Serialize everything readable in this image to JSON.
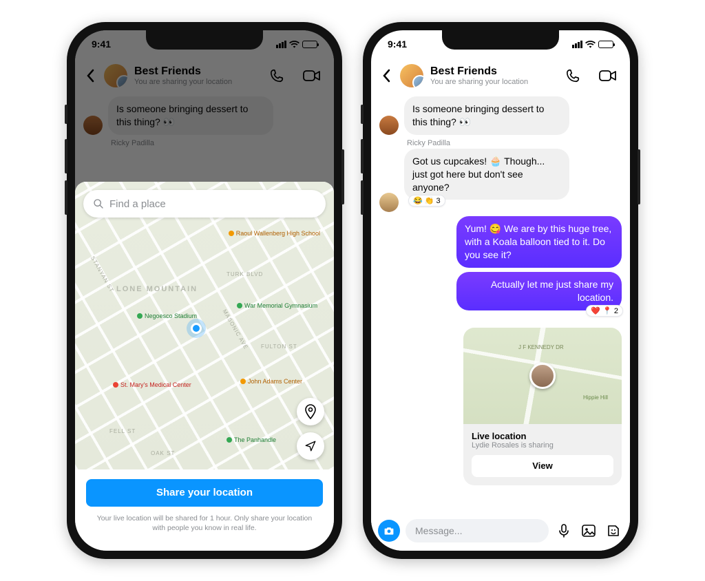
{
  "status": {
    "time": "9:41"
  },
  "header": {
    "title": "Best Friends",
    "subtitle": "You are sharing your location"
  },
  "left": {
    "msg1": "Is someone bringing dessert to this thing? 👀",
    "sender1": "Ricky Padilla",
    "search_placeholder": "Find a place",
    "map": {
      "neighborhood": "LONE MOUNTAIN",
      "poi_stadium": "Negoesco Stadium",
      "poi_gym": "War Memorial Gymnasium",
      "poi_hospital": "St. Mary's Medical Center",
      "poi_school": "Raoul Wallenberg High School",
      "poi_center": "John Adams Center",
      "poi_park": "The Panhandle",
      "street_turk": "TURK BLVD",
      "street_fulton": "FULTON ST",
      "street_fell": "FELL ST",
      "street_oak": "OAK ST",
      "street_stanyan": "STANYAN ST",
      "street_masonic": "MASONIC AVE"
    },
    "share_button": "Share your location",
    "disclaimer": "Your live location will be shared for 1 hour. Only share your location with people you know in real life."
  },
  "right": {
    "msg1": "Is someone bringing dessert to this thing? 👀",
    "sender1": "Ricky Padilla",
    "msg2": "Got us cupcakes! 🧁 Though... just got here but don't see anyone?",
    "react2": "😂 👏 3",
    "msg3": "Yum! 😋 We are by this huge tree, with a Koala balloon tied to it. Do you see it?",
    "msg4": "Actually let me just share my location.",
    "react4": "❤️ 📍 2",
    "location_card": {
      "title": "Live location",
      "subtitle": "Lydie Rosales is sharing",
      "button": "View",
      "map_label1": "J F KENNEDY DR",
      "map_label2": "Hippie Hill"
    },
    "composer_placeholder": "Message..."
  }
}
